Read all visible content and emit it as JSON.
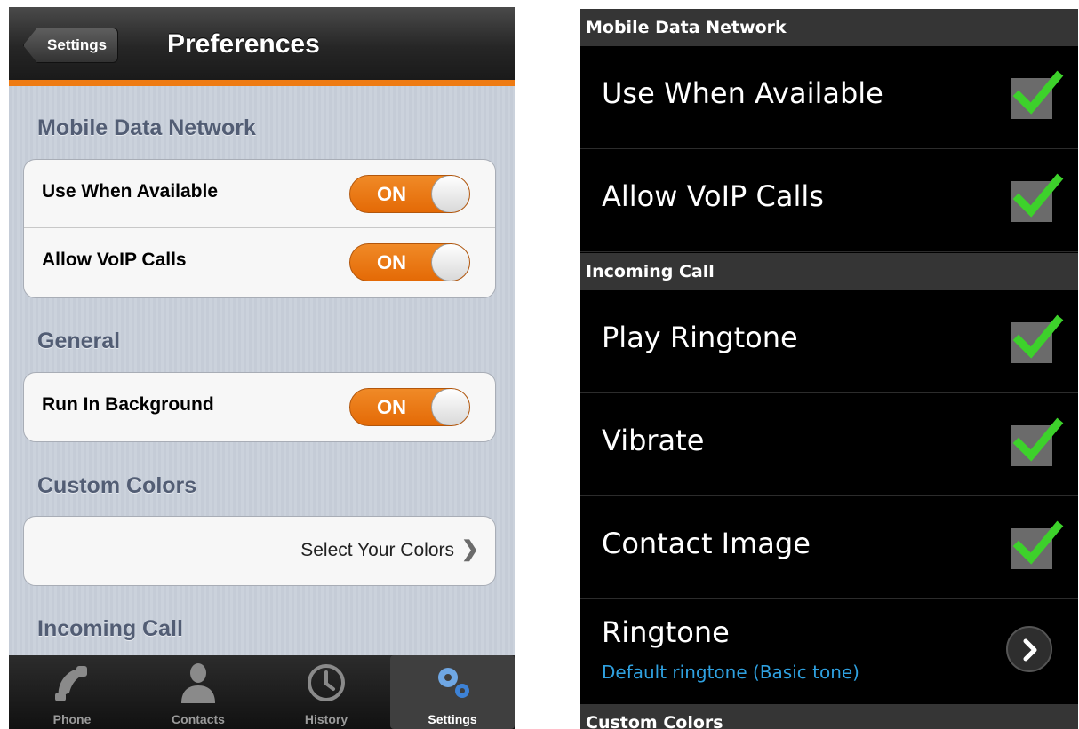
{
  "ios": {
    "navbar": {
      "back_label": "Settings",
      "title": "Preferences"
    },
    "sections": [
      {
        "title": "Mobile Data Network",
        "rows": [
          {
            "label": "Use When Available",
            "toggle": "ON"
          },
          {
            "label": "Allow VoIP Calls",
            "toggle": "ON"
          }
        ]
      },
      {
        "title": "General",
        "rows": [
          {
            "label": "Run In Background",
            "toggle": "ON"
          }
        ]
      },
      {
        "title": "Custom Colors",
        "link": {
          "label": "Select Your Colors",
          "icon": "chevron-right-icon"
        }
      },
      {
        "title": "Incoming Call"
      }
    ],
    "tabbar": [
      {
        "label": "Phone",
        "icon": "phone-icon",
        "active": false
      },
      {
        "label": "Contacts",
        "icon": "contacts-icon",
        "active": false
      },
      {
        "label": "History",
        "icon": "clock-icon",
        "active": false
      },
      {
        "label": "Settings",
        "icon": "gears-icon",
        "active": true
      }
    ],
    "accent_color": "#ee7b13"
  },
  "android": {
    "sections": [
      {
        "title": "Mobile Data Network",
        "rows": [
          {
            "label": "Use When Available",
            "checked": true
          },
          {
            "label": "Allow VoIP Calls",
            "checked": true
          }
        ]
      },
      {
        "title": "Incoming Call",
        "rows": [
          {
            "label": "Play Ringtone",
            "checked": true
          },
          {
            "label": "Vibrate",
            "checked": true
          },
          {
            "label": "Contact Image",
            "checked": true
          },
          {
            "label": "Ringtone",
            "sublabel": "Default ringtone (Basic tone)",
            "icon": "arrow-right-icon"
          }
        ]
      },
      {
        "title": "Custom Colors"
      }
    ],
    "check_color": "#3dd12b",
    "sublabel_color": "#2fa1e0"
  }
}
